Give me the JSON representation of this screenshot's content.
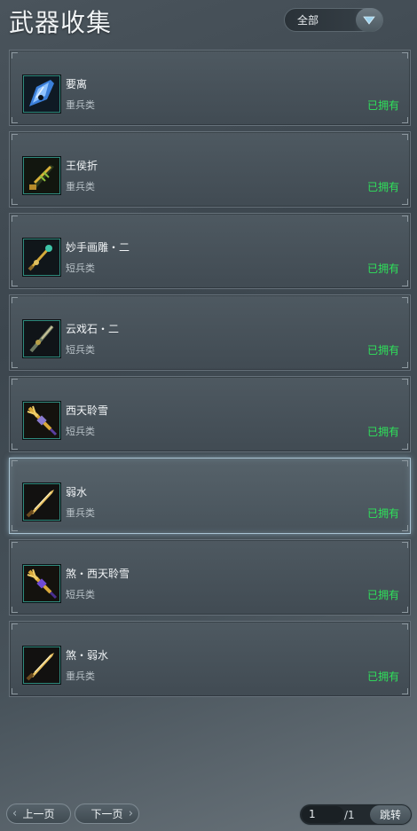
{
  "title": "武器收集",
  "filter": {
    "selected": "全部"
  },
  "weapons": [
    {
      "name": "要离",
      "type": "重兵类",
      "status": "已拥有",
      "icon": "blue-crystal-blade-icon"
    },
    {
      "name": "王侯折",
      "type": "重兵类",
      "status": "已拥有",
      "icon": "gold-green-greatsword-icon"
    },
    {
      "name": "妙手画雕・二",
      "type": "短兵类",
      "status": "已拥有",
      "icon": "jade-dagger-icon"
    },
    {
      "name": "云戏石・二",
      "type": "短兵类",
      "status": "已拥有",
      "icon": "stone-dagger-icon"
    },
    {
      "name": "西天聆雪",
      "type": "短兵类",
      "status": "已拥有",
      "icon": "gold-trident-dagger-icon"
    },
    {
      "name": "弱水",
      "type": "重兵类",
      "status": "已拥有",
      "icon": "gold-blade-icon"
    },
    {
      "name": "煞・西天聆雪",
      "type": "短兵类",
      "status": "已拥有",
      "icon": "purple-trident-dagger-icon"
    },
    {
      "name": "煞・弱水",
      "type": "重兵类",
      "status": "已拥有",
      "icon": "gold-blade-icon"
    }
  ],
  "selected_index": 5,
  "pager": {
    "prev_label": "上一页",
    "next_label": "下一页",
    "current_page": "1",
    "total_pages": "/1",
    "jump_label": "跳转"
  },
  "colors": {
    "owned": "#2ee25a",
    "frame": "#2f8a7d",
    "selected_border": "#a9c3d2"
  }
}
